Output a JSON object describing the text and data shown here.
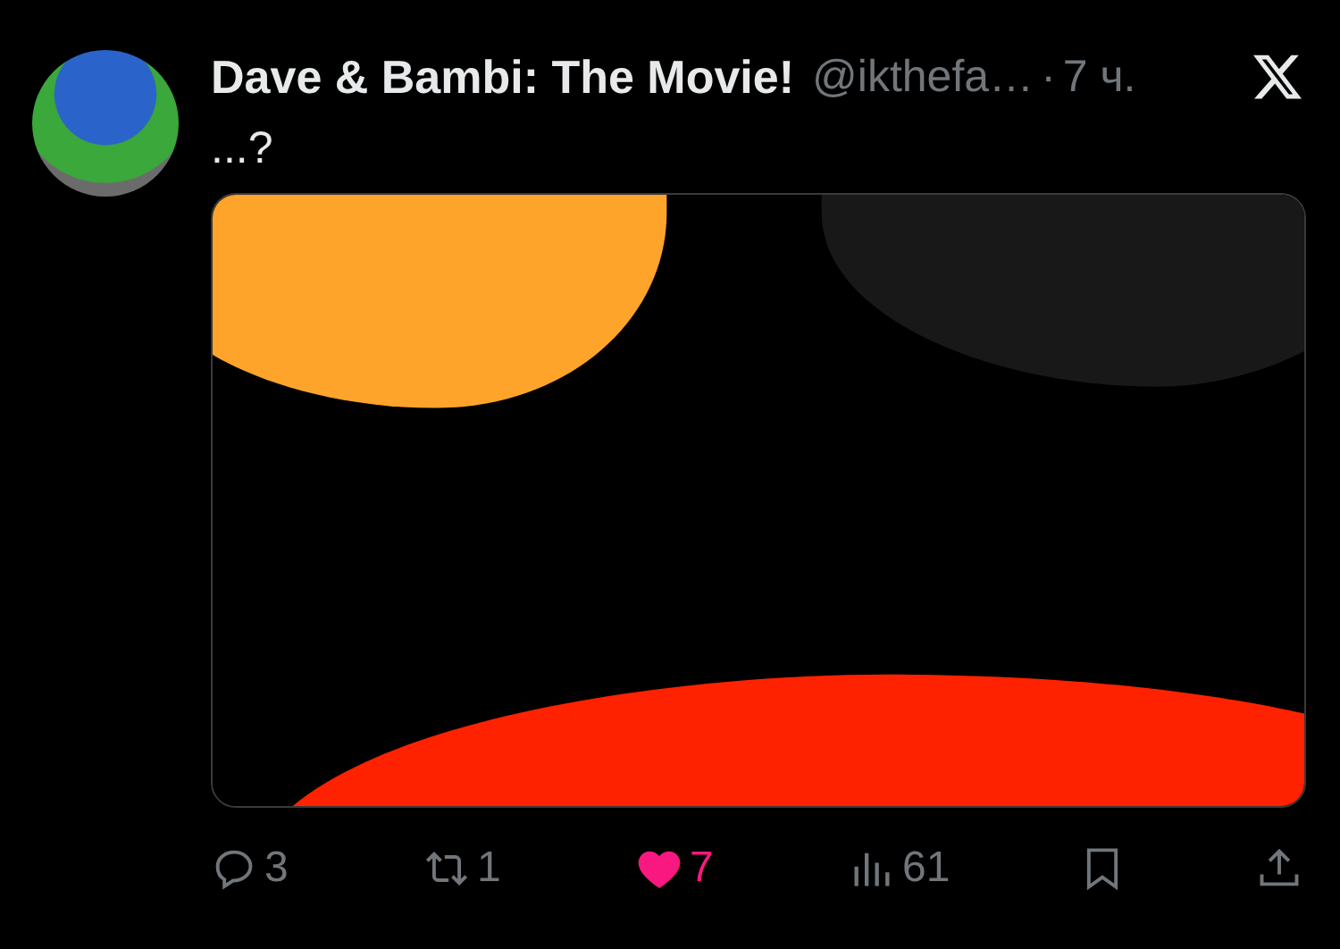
{
  "post": {
    "author_name": "Dave & Bambi: The Movie!",
    "handle": "@ikthefa…",
    "separator": "·",
    "time": "7 ч.",
    "text": "...?"
  },
  "actions": [
    {
      "kind": "reply",
      "count": "3"
    },
    {
      "kind": "repost",
      "count": "1"
    },
    {
      "kind": "like",
      "count": "7",
      "liked": true
    },
    {
      "kind": "views",
      "count": "61"
    },
    {
      "kind": "bookmark"
    },
    {
      "kind": "share"
    }
  ]
}
